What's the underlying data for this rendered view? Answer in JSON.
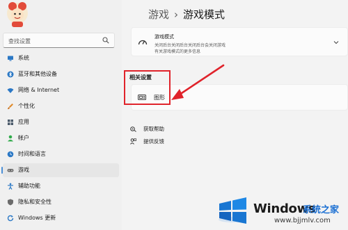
{
  "sidebar": {
    "search_placeholder": "查找设置",
    "items": [
      {
        "label": "系统",
        "icon": "monitor-icon",
        "color": "#2b78c5"
      },
      {
        "label": "蓝牙和其他设备",
        "icon": "bluetooth-icon",
        "color": "#2b78c5"
      },
      {
        "label": "网络 & Internet",
        "icon": "wifi-icon",
        "color": "#2b78c5"
      },
      {
        "label": "个性化",
        "icon": "brush-icon",
        "color": "#e08a2a"
      },
      {
        "label": "应用",
        "icon": "apps-icon",
        "color": "#4a5a6a"
      },
      {
        "label": "帐户",
        "icon": "person-icon",
        "color": "#2faa4a"
      },
      {
        "label": "时间和语言",
        "icon": "globe-clock-icon",
        "color": "#2b78c5"
      },
      {
        "label": "游戏",
        "icon": "gamepad-icon",
        "color": "#6b6b6b",
        "selected": true
      },
      {
        "label": "辅助功能",
        "icon": "accessibility-icon",
        "color": "#2b78c5"
      },
      {
        "label": "隐私和安全性",
        "icon": "shield-icon",
        "color": "#6b6b6b"
      },
      {
        "label": "Windows 更新",
        "icon": "update-icon",
        "color": "#2b78c5"
      }
    ]
  },
  "header": {
    "parent": "游戏",
    "current": "游戏模式"
  },
  "mode_card": {
    "title": "游戏模式",
    "description": "关闭后台关闭后台关闭后台会关闭游戏",
    "description2": "有关游戏模式的更多信息"
  },
  "related": {
    "heading": "相关设置",
    "graphics_label": "图形"
  },
  "links": {
    "help": "获取帮助",
    "feedback": "提供反馈"
  },
  "watermark": {
    "word": "Windows",
    "cn": "系统之家",
    "url": "www.bjjmlv.com"
  },
  "colors": {
    "accent": "#4b8fd6",
    "highlight": "#e0232b"
  }
}
